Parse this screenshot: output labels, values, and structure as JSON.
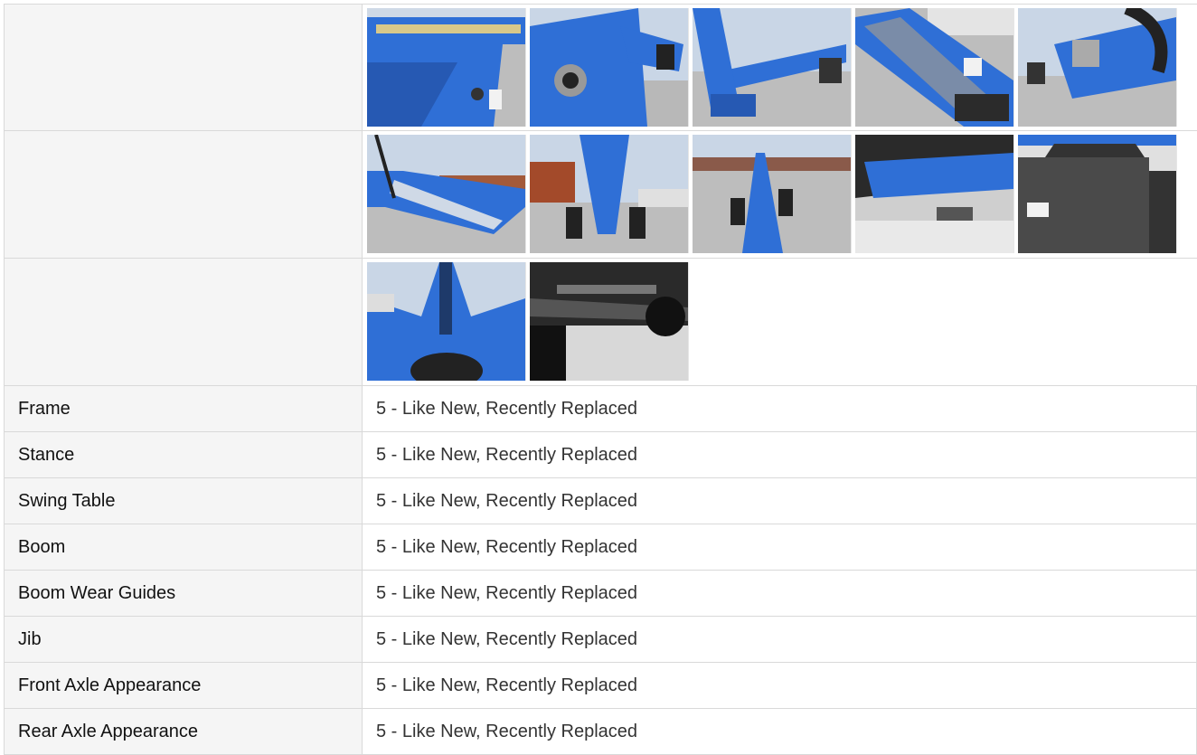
{
  "photo_rows": [
    {
      "label": "",
      "photos": [
        {
          "subject": "boom side panel"
        },
        {
          "subject": "boom pivot pin"
        },
        {
          "subject": "boom extended over lot"
        },
        {
          "subject": "telescoping boom section"
        },
        {
          "subject": "boom hoses and cylinder"
        }
      ]
    },
    {
      "label": "",
      "photos": [
        {
          "subject": "jib arm in lot"
        },
        {
          "subject": "rear view tires"
        },
        {
          "subject": "boom along yard"
        },
        {
          "subject": "chassis underside"
        },
        {
          "subject": "counterweight"
        }
      ]
    },
    {
      "label": "",
      "photos": [
        {
          "subject": "boom base from below"
        },
        {
          "subject": "axle and steering cylinder"
        }
      ]
    }
  ],
  "inspection_rows": [
    {
      "label": "Frame",
      "value": "5 - Like New, Recently Replaced"
    },
    {
      "label": "Stance",
      "value": "5 - Like New, Recently Replaced"
    },
    {
      "label": "Swing Table",
      "value": "5 - Like New, Recently Replaced"
    },
    {
      "label": "Boom",
      "value": "5 - Like New, Recently Replaced"
    },
    {
      "label": "Boom Wear Guides",
      "value": "5 - Like New, Recently Replaced"
    },
    {
      "label": "Jib",
      "value": "5 - Like New, Recently Replaced"
    },
    {
      "label": "Front Axle Appearance",
      "value": "5 - Like New, Recently Replaced"
    },
    {
      "label": "Rear Axle Appearance",
      "value": "5 - Like New, Recently Replaced"
    }
  ],
  "colors": {
    "machine_blue": "#2f6fd6",
    "sky": "#c9d6e6",
    "ground": "#bdbdbd",
    "dark": "#3a3a3a"
  }
}
